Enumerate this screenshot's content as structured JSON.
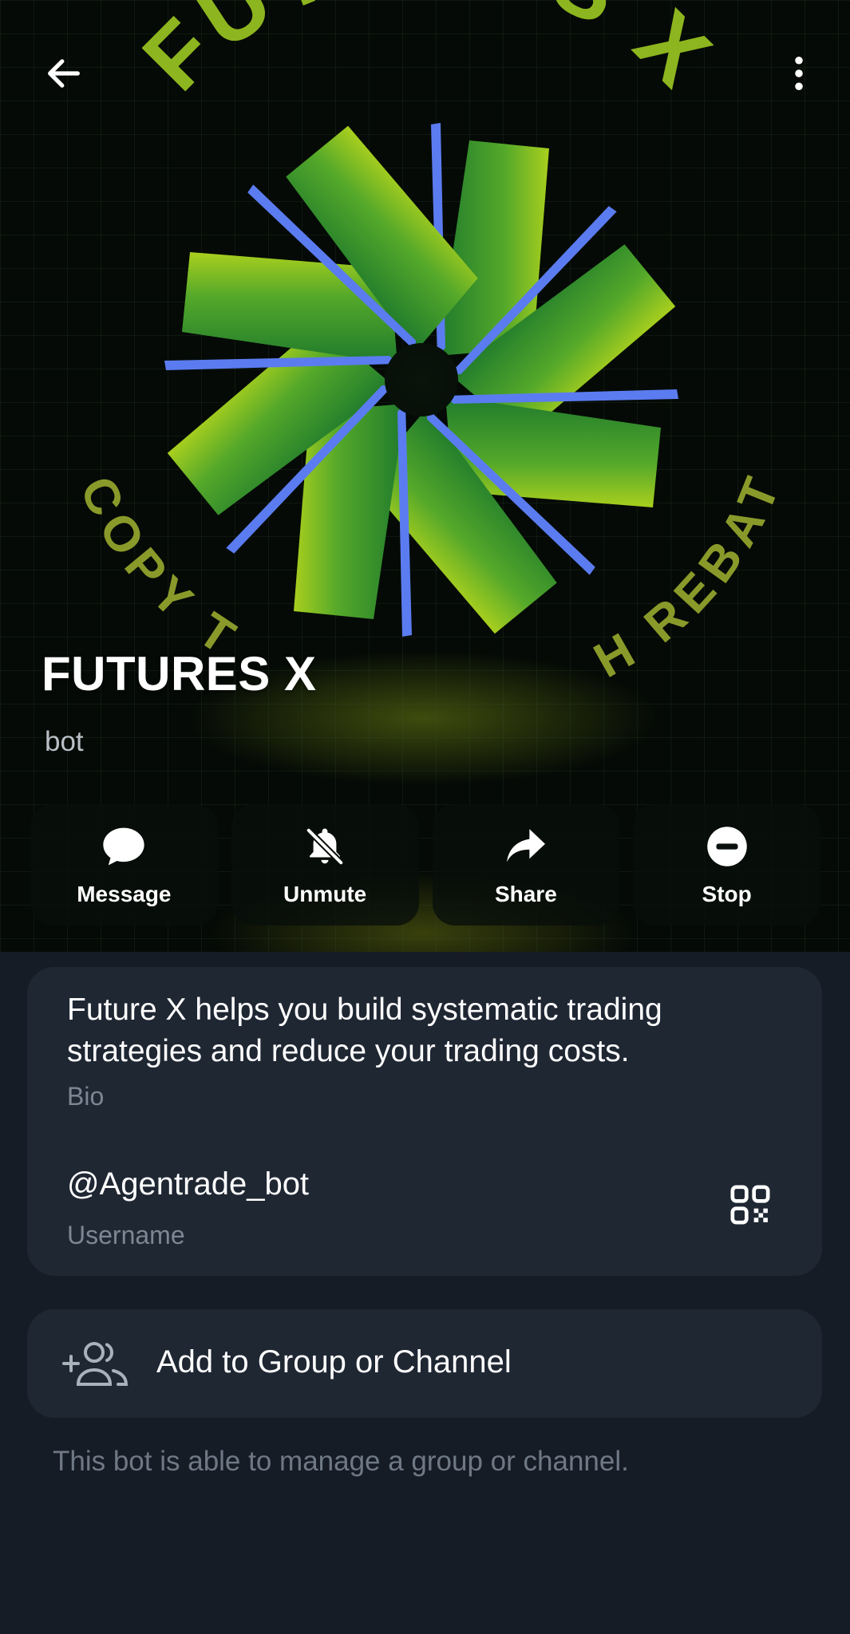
{
  "header": {
    "back_icon": "arrow-left-icon",
    "menu_icon": "more-vertical-icon"
  },
  "avatar": {
    "logo_top_text": "FUTURES X",
    "logo_bottom_left_text": "COPY T",
    "logo_bottom_right_text": "H REBATE",
    "colors": {
      "green": "#3a9a2a",
      "lime": "#9cc31c",
      "blue": "#5b7cf0"
    }
  },
  "profile": {
    "name": "FUTURES X",
    "type": "bot"
  },
  "actions": [
    {
      "label": "Message",
      "icon": "message-icon"
    },
    {
      "label": "Unmute",
      "icon": "bell-off-icon"
    },
    {
      "label": "Share",
      "icon": "share-arrow-icon"
    },
    {
      "label": "Stop",
      "icon": "stop-circle-icon"
    }
  ],
  "info": {
    "bio": "Future X helps you build systematic trading strategies and reduce your trading costs.",
    "bio_label": "Bio",
    "username": "@Agentrade_bot",
    "username_label": "Username",
    "qr_icon": "qr-code-icon"
  },
  "add_group": {
    "label": "Add to Group or Channel",
    "icon": "add-users-icon"
  },
  "footnote": "This bot is able to manage a group or channel.",
  "theme": {
    "background": "#161c26",
    "card": "#1f2733",
    "muted_text": "#7d8793"
  }
}
